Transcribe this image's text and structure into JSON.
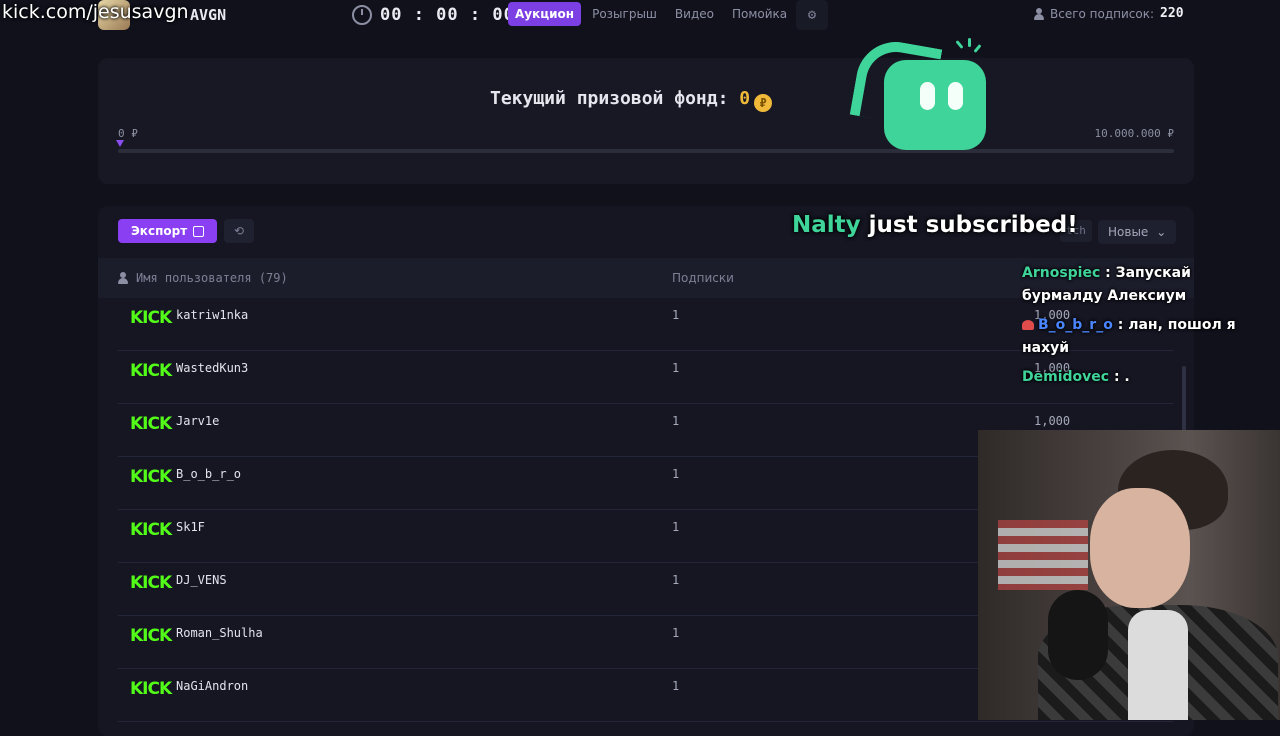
{
  "overlay": {
    "url_text": "kick.com/jesusavgn"
  },
  "header": {
    "channel_name": "AVGN",
    "timer": "00 : 00 : 00",
    "tabs": [
      {
        "label": "Аукцион",
        "active": true
      },
      {
        "label": "Розыгрыш",
        "active": false
      },
      {
        "label": "Видео",
        "active": false
      },
      {
        "label": "Помойка",
        "active": false
      }
    ],
    "subs_label": "Всего подписок:",
    "subs_count": "220"
  },
  "prize": {
    "title": "Текущий призовой фонд:",
    "amount": "0",
    "coin_symbol": "₽",
    "scale_min": "0 ₽",
    "scale_max": "10.000.000 ₽",
    "progress_fraction": 0
  },
  "toolbar": {
    "export_label": "Экспорт",
    "sort_label": "Новые",
    "hidden_chip": "tch"
  },
  "table": {
    "col_user": "Имя пользователя (79)",
    "col_subs": "Подписки",
    "rows": [
      {
        "platform": "KICK",
        "user": "katriw1nka",
        "subs": "1",
        "amount": "1,000"
      },
      {
        "platform": "KICK",
        "user": "WastedKun3",
        "subs": "1",
        "amount": "1,000"
      },
      {
        "platform": "KICK",
        "user": "Jarv1e",
        "subs": "1",
        "amount": "1,000"
      },
      {
        "platform": "KICK",
        "user": "B_o_b_r_o",
        "subs": "1",
        "amount": ""
      },
      {
        "platform": "KICK",
        "user": "Sk1F",
        "subs": "1",
        "amount": ""
      },
      {
        "platform": "KICK",
        "user": "DJ_VENS",
        "subs": "1",
        "amount": ""
      },
      {
        "platform": "KICK",
        "user": "Roman_Shulha",
        "subs": "1",
        "amount": ""
      },
      {
        "platform": "KICK",
        "user": "NaGiAndron",
        "subs": "1",
        "amount": ""
      }
    ]
  },
  "alert": {
    "who": "Nalty",
    "rest": " just subscribed!"
  },
  "chat": [
    {
      "name": "Arnospiec",
      "text": ": Запускай бурмалду Алексиум"
    },
    {
      "name": "B_o_b_r_o",
      "text": ": лан, пошол я нахуй"
    },
    {
      "name": "Demidovec",
      "text": ": ."
    }
  ],
  "colors": {
    "accent": "#8a3ff2",
    "kick_green": "#53fc18",
    "coin": "#f0b93a",
    "robot": "#3fd49a"
  }
}
